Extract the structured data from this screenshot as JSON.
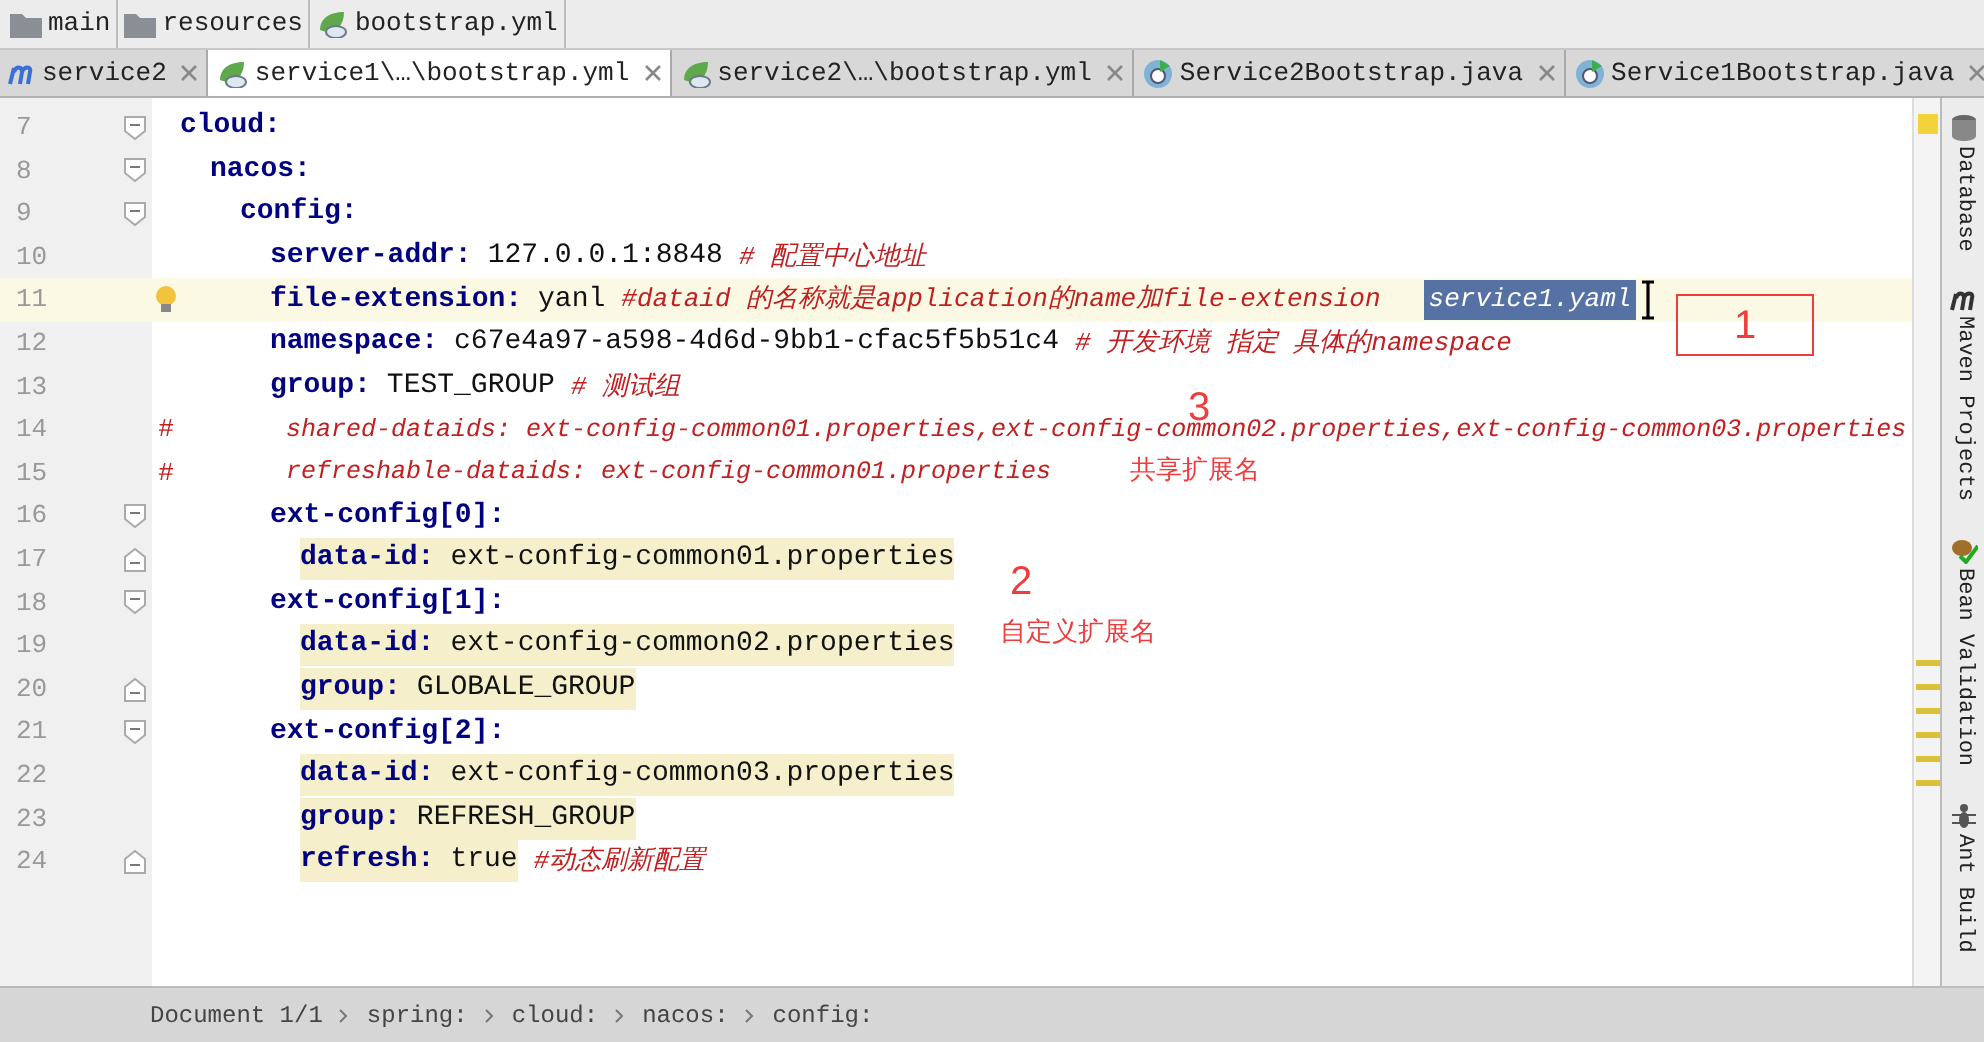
{
  "breadcrumbs": [
    {
      "label": "main",
      "kind": "folder"
    },
    {
      "label": "resources",
      "kind": "folder"
    },
    {
      "label": "bootstrap.yml",
      "kind": "yaml"
    }
  ],
  "tabs": [
    {
      "label": "service2",
      "kind": "maven",
      "selected": false
    },
    {
      "label": "service1\\…\\bootstrap.yml",
      "kind": "yaml",
      "selected": true
    },
    {
      "label": "service2\\…\\bootstrap.yml",
      "kind": "yaml",
      "selected": false
    },
    {
      "label": "Service2Bootstrap.java",
      "kind": "java",
      "selected": false
    },
    {
      "label": "Service1Bootstrap.java",
      "kind": "java",
      "selected": false
    }
  ],
  "lines": [
    {
      "number": "7",
      "fold_open": true,
      "fold_close": false,
      "key": "cloud:",
      "children": [
        {
          "number": "8",
          "fold_open": true,
          "fold_close": false,
          "key": "nacos:",
          "children": [
            {
              "number": "9",
              "fold_open": true,
              "fold_close": false,
              "key": "config:",
              "children": [
                {
                  "number": "10",
                  "fold_open": false,
                  "fold_close": false,
                  "key": "server-addr:",
                  "value": "127.0.0.1:8848",
                  "comment": "# 配置中心地址"
                },
                {
                  "number": "11",
                  "fold_open": false,
                  "fold_close": false,
                  "key": "file-extension:",
                  "value": "yanl",
                  "comment": "#dataid 的名称就是application的name加file-extension",
                  "selection": "service1.yaml",
                  "current": true,
                  "bulb": true
                },
                {
                  "number": "12",
                  "fold_open": false,
                  "fold_close": false,
                  "key": "namespace:",
                  "value": "c67e4a97-a598-4d6d-9bb1-cfac5f5b51c4",
                  "comment": "# 开发环境  指定 具体的namespace"
                },
                {
                  "number": "13",
                  "fold_open": false,
                  "fold_close": false,
                  "key": "group:",
                  "value": "TEST_GROUP",
                  "comment": "# 测试组"
                },
                {
                  "number": "14",
                  "fold_open": false,
                  "fold_close": false,
                  "commented": true,
                  "mark": "#",
                  "text": "shared-dataids: ext-config-common01.properties,ext-config-common02.properties,ext-config-common03.properties"
                },
                {
                  "number": "15",
                  "fold_open": false,
                  "fold_close": false,
                  "commented": true,
                  "mark": "#",
                  "text": "refreshable-dataids: ext-config-common01.properties"
                },
                {
                  "number": "16",
                  "fold_open": true,
                  "fold_close": false,
                  "key": "ext-config[0]:",
                  "children": [
                    {
                      "number": "17",
                      "fold_open": false,
                      "fold_close": true,
                      "key": "data-id:",
                      "value": "ext-config-common01.properties",
                      "highlighted": true
                    }
                  ]
                },
                {
                  "number": "18",
                  "fold_open": true,
                  "fold_close": false,
                  "key": "ext-config[1]:",
                  "children": [
                    {
                      "number": "19",
                      "fold_open": false,
                      "fold_close": false,
                      "key": "data-id:",
                      "value": "ext-config-common02.properties",
                      "highlighted": true
                    },
                    {
                      "number": "20",
                      "fold_open": false,
                      "fold_close": true,
                      "key": "group:",
                      "value": "GLOBALE_GROUP",
                      "highlighted": true
                    }
                  ]
                },
                {
                  "number": "21",
                  "fold_open": true,
                  "fold_close": false,
                  "key": "ext-config[2]:",
                  "children": [
                    {
                      "number": "22",
                      "fold_open": false,
                      "fold_close": false,
                      "key": "data-id:",
                      "value": "ext-config-common03.properties",
                      "highlighted": true
                    },
                    {
                      "number": "23",
                      "fold_open": false,
                      "fold_close": false,
                      "key": "group:",
                      "value": "REFRESH_GROUP",
                      "highlighted": true
                    },
                    {
                      "number": "24",
                      "fold_open": false,
                      "fold_close": true,
                      "key": "refresh:",
                      "value": "true",
                      "comment": "#动态刷新配置",
                      "highlighted": true
                    }
                  ]
                }
              ]
            }
          ]
        }
      ]
    }
  ],
  "annotations": [
    {
      "text": "1",
      "boxed": true
    },
    {
      "text": "3",
      "boxed": false
    },
    {
      "text": "共享扩展名",
      "boxed": false
    },
    {
      "text": "2",
      "boxed": false
    },
    {
      "text": "自定义扩展名",
      "boxed": false
    }
  ],
  "tool_windows": [
    {
      "label": "Database",
      "kind": "database"
    },
    {
      "label": "Maven Projects",
      "kind": "maven"
    },
    {
      "label": "Bean Validation",
      "kind": "bean"
    },
    {
      "label": "Ant Build",
      "kind": "ant"
    }
  ],
  "status_path": [
    "Document 1/1",
    "spring:",
    "cloud:",
    "nacos:",
    "config:"
  ]
}
